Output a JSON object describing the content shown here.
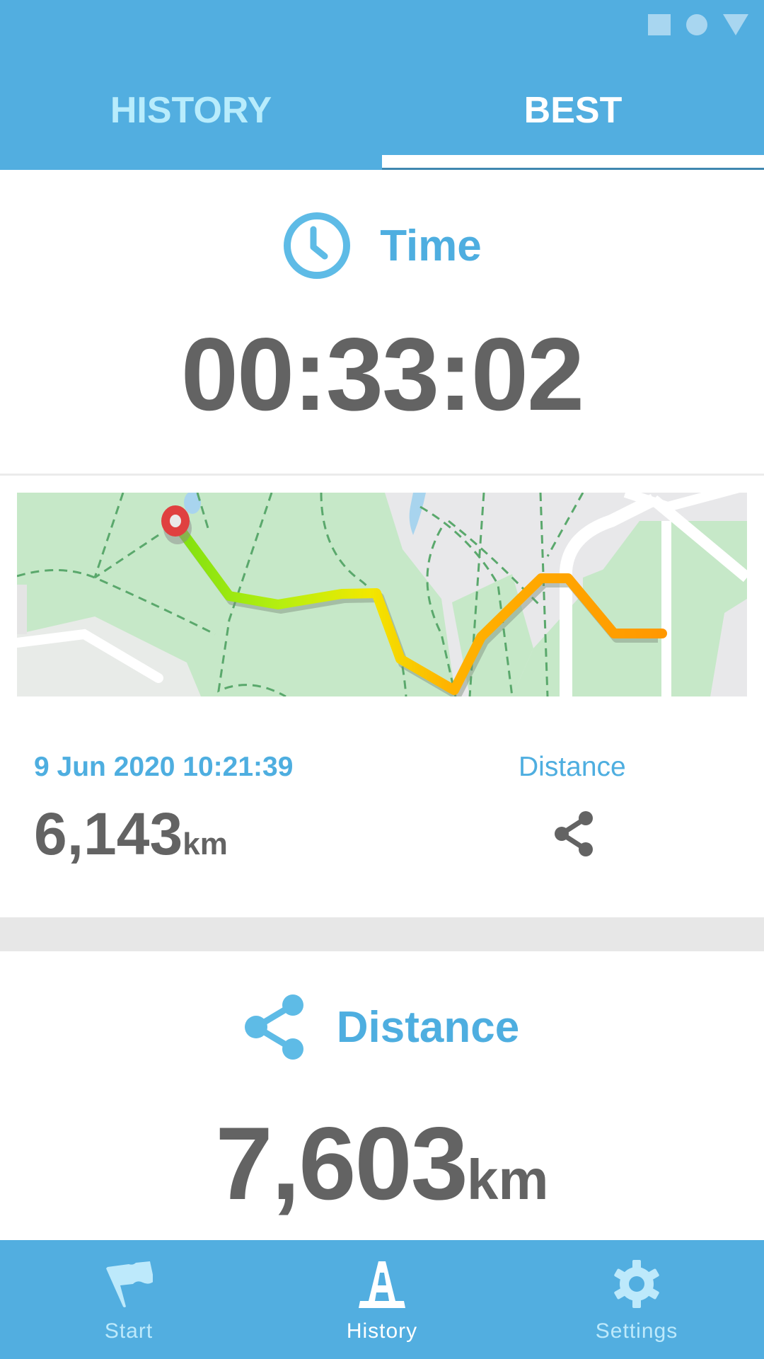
{
  "status_bar": {
    "icons": [
      "square-icon",
      "circle-icon",
      "triangle-icon"
    ]
  },
  "tabs": [
    {
      "label": "HISTORY",
      "active": false
    },
    {
      "label": "BEST",
      "active": true
    }
  ],
  "time_section": {
    "icon": "clock-icon",
    "title": "Time",
    "value": "00:33:02"
  },
  "record": {
    "datetime": "9 Jun 2020 10:21:39",
    "metric_label": "Distance",
    "distance_value": "6,143",
    "distance_unit": "km",
    "share_icon": "share-icon"
  },
  "distance_section": {
    "icon": "share-icon",
    "title": "Distance",
    "value": "7,603",
    "unit": "km"
  },
  "bottom_nav": [
    {
      "label": "Start",
      "icon": "flag-icon",
      "active": false
    },
    {
      "label": "History",
      "icon": "traffic-cone-icon",
      "active": true
    },
    {
      "label": "Settings",
      "icon": "gear-icon",
      "active": false
    }
  ],
  "colors": {
    "primary": "#52aee0",
    "accent_text": "#4eaee0",
    "value_text": "#636363",
    "inactive_tab": "#b8ecfc",
    "route_start": "#7ee010",
    "route_mid": "#f2e800",
    "route_end": "#ff9800",
    "marker": "#e04040"
  }
}
